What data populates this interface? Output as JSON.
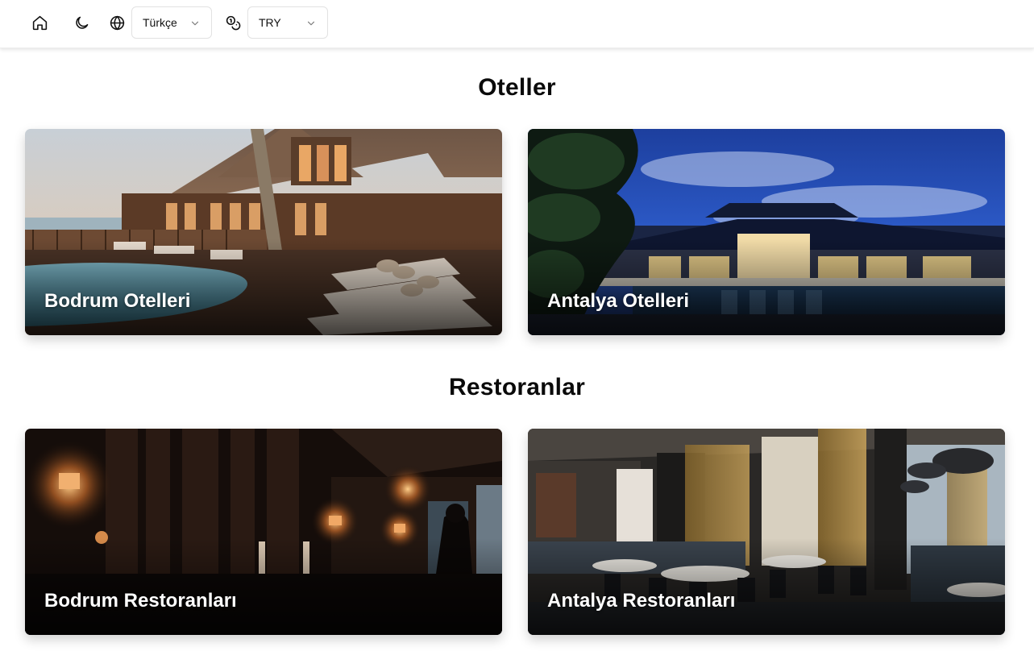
{
  "header": {
    "language": {
      "value": "Türkçe"
    },
    "currency": {
      "value": "TRY"
    },
    "icons": [
      "home-icon",
      "moon-icon",
      "globe-icon",
      "coins-icon",
      "chevron-down-icon"
    ]
  },
  "sections": [
    {
      "title": "Oteller",
      "cards": [
        {
          "label": "Bodrum Otelleri"
        },
        {
          "label": "Antalya Otelleri"
        }
      ]
    },
    {
      "title": "Restoranlar",
      "cards": [
        {
          "label": "Bodrum Restoranları"
        },
        {
          "label": "Antalya Restoranları"
        }
      ]
    }
  ],
  "colors": {
    "text": "#0a0a0a",
    "border": "#e2e2e2",
    "card_label": "#ffffff"
  }
}
